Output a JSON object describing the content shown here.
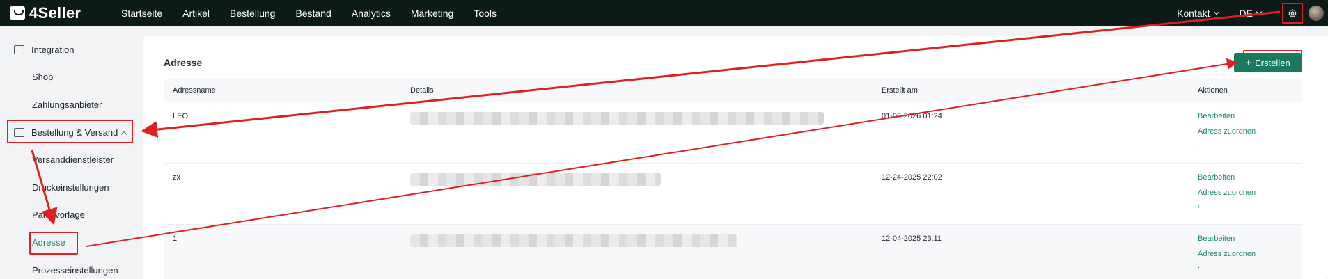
{
  "app": {
    "name": "4Seller"
  },
  "nav": {
    "items": [
      "Startseite",
      "Artikel",
      "Bestellung",
      "Bestand",
      "Analytics",
      "Marketing",
      "Tools"
    ],
    "contact": "Kontakt",
    "language": "DE"
  },
  "sidebar": {
    "integration": "Integration",
    "shop": "Shop",
    "payment": "Zahlungsanbieter",
    "order_group": "Bestellung & Versand",
    "carrier": "Versanddienstleister",
    "print": "Druckeinstellungen",
    "package": "Paketvorlage",
    "address": "Adresse",
    "process": "Prozesseinstellungen"
  },
  "main": {
    "title": "Adresse",
    "create_label": "Erstellen",
    "create_icon": "+",
    "columns": [
      "Adressname",
      "Details",
      "Erstellt am",
      "Aktionen"
    ],
    "rows": [
      {
        "name": "LEO",
        "created": "01-06-2026 01:24"
      },
      {
        "name": "zx",
        "created": "12-24-2025 22:02"
      },
      {
        "name": "1",
        "created": "12-04-2025 23:11"
      }
    ],
    "actions": {
      "edit": "Bearbeiten",
      "assign": "Adress zuordnen",
      "more": "..."
    }
  },
  "colors": {
    "accent": "#1a7a5f",
    "topbar": "#0d1b18",
    "annotation": "#e02020"
  }
}
